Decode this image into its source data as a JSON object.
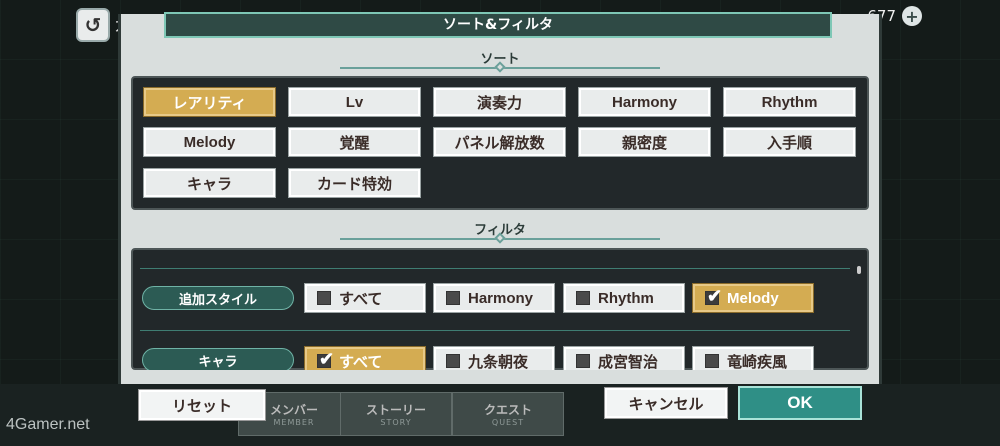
{
  "header": {
    "back_icon": "back-arrow-icon",
    "bg_title": "カー",
    "currency_value": "677",
    "modal_title": "ソート&フィルタ"
  },
  "sort": {
    "title": "ソート",
    "options": [
      {
        "label": "レアリティ",
        "active": true
      },
      {
        "label": "Lv",
        "active": false
      },
      {
        "label": "演奏力",
        "active": false
      },
      {
        "label": "Harmony",
        "active": false
      },
      {
        "label": "Rhythm",
        "active": false
      },
      {
        "label": "Melody",
        "active": false
      },
      {
        "label": "覚醒",
        "active": false
      },
      {
        "label": "パネル解放数",
        "active": false
      },
      {
        "label": "親密度",
        "active": false
      },
      {
        "label": "入手順",
        "active": false
      },
      {
        "label": "キャラ",
        "active": false
      },
      {
        "label": "カード特効",
        "active": false
      }
    ]
  },
  "filter": {
    "title": "フィルタ",
    "rows": [
      {
        "label": "追加スタイル",
        "options": [
          {
            "label": "すべて",
            "checked": false
          },
          {
            "label": "Harmony",
            "checked": false
          },
          {
            "label": "Rhythm",
            "checked": false
          },
          {
            "label": "Melody",
            "checked": true
          }
        ]
      },
      {
        "label": "キャラ",
        "options": [
          {
            "label": "すべて",
            "checked": true
          },
          {
            "label": "九条朝夜",
            "checked": false
          },
          {
            "label": "成宮智治",
            "checked": false
          },
          {
            "label": "竜崎疾風",
            "checked": false
          }
        ]
      }
    ]
  },
  "footer": {
    "reset_label": "リセット",
    "cancel_label": "キャンセル",
    "ok_label": "OK",
    "tabs": [
      {
        "label": "メンバー",
        "sub": "MEMBER"
      },
      {
        "label": "ストーリー",
        "sub": "STORY"
      },
      {
        "label": "クエスト",
        "sub": "QUEST"
      }
    ],
    "watermark": "4Gamer.net"
  }
}
